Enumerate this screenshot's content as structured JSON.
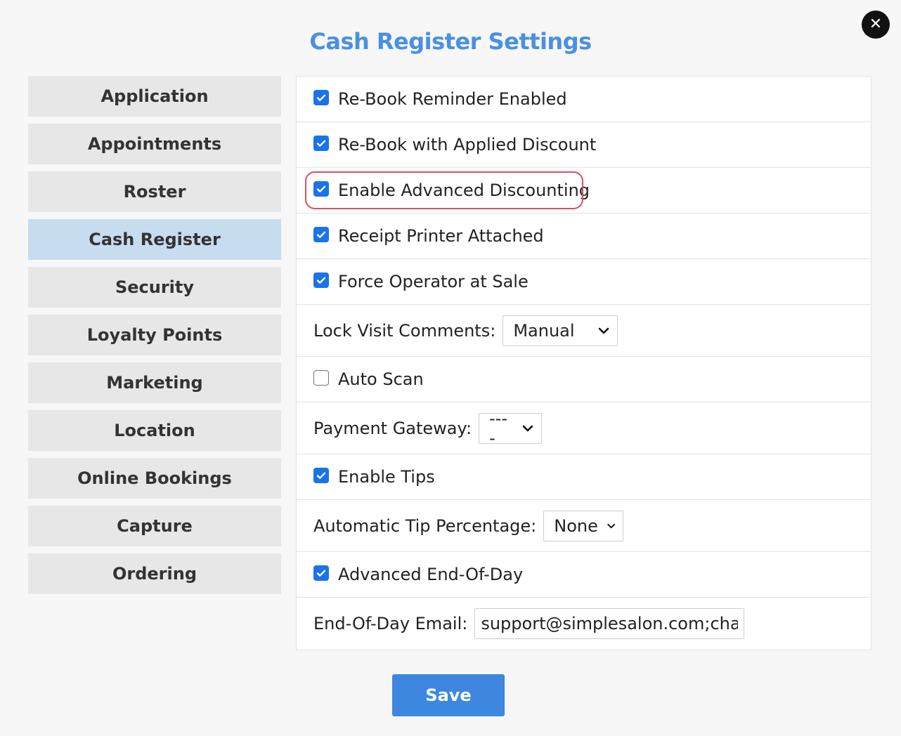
{
  "dialog": {
    "title": "Cash Register Settings",
    "close_icon": "close-icon",
    "save_label": "Save"
  },
  "sidebar": {
    "active": "Cash Register",
    "items": [
      {
        "label": "Application"
      },
      {
        "label": "Appointments"
      },
      {
        "label": "Roster"
      },
      {
        "label": "Cash Register"
      },
      {
        "label": "Security"
      },
      {
        "label": "Loyalty Points"
      },
      {
        "label": "Marketing"
      },
      {
        "label": "Location"
      },
      {
        "label": "Online Bookings"
      },
      {
        "label": "Capture"
      },
      {
        "label": "Ordering"
      }
    ]
  },
  "settings": {
    "rebook_reminder": {
      "label": "Re-Book Reminder Enabled",
      "checked": true
    },
    "rebook_discount": {
      "label": "Re-Book with Applied Discount",
      "checked": true
    },
    "advanced_discounting": {
      "label": "Enable Advanced Discounting",
      "checked": true
    },
    "receipt_printer": {
      "label": "Receipt Printer Attached",
      "checked": true
    },
    "force_operator": {
      "label": "Force Operator at Sale",
      "checked": true
    },
    "lock_visit_comments": {
      "label": "Lock Visit Comments:",
      "value": "Manual"
    },
    "auto_scan": {
      "label": "Auto Scan",
      "checked": false
    },
    "payment_gateway": {
      "label": "Payment Gateway:",
      "value": "----"
    },
    "enable_tips": {
      "label": "Enable Tips",
      "checked": true
    },
    "auto_tip_percentage": {
      "label": "Automatic Tip Percentage:",
      "value": "None"
    },
    "advanced_eod": {
      "label": "Advanced End-Of-Day",
      "checked": true
    },
    "eod_email": {
      "label": "End-Of-Day Email:",
      "value": "support@simplesalon.com;charle"
    }
  },
  "colors": {
    "accent": "#4a90e2",
    "checkbox": "#1a73e8",
    "highlight": "#d9505f",
    "active_tab": "#c7dcef",
    "save_button": "#3d87e0"
  }
}
